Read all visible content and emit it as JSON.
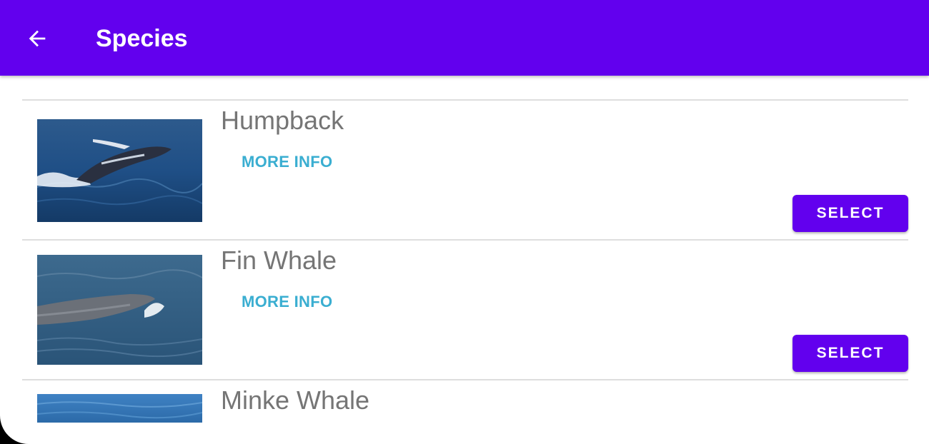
{
  "appbar": {
    "title": "Species",
    "back_icon": "arrow-left-icon",
    "color": "#6200ee"
  },
  "species": [
    {
      "name": "Humpback",
      "more_info_label": "MORE INFO",
      "select_label": "SELECT",
      "image": "humpback-whale-breaching-photo"
    },
    {
      "name": "Fin Whale",
      "more_info_label": "MORE INFO",
      "select_label": "SELECT",
      "image": "fin-whale-surfacing-photo"
    },
    {
      "name": "Minke Whale",
      "image": "minke-whale-ocean-photo"
    }
  ],
  "colors": {
    "accent": "#6200ee",
    "link": "#3aaed1",
    "text": "#757575"
  }
}
